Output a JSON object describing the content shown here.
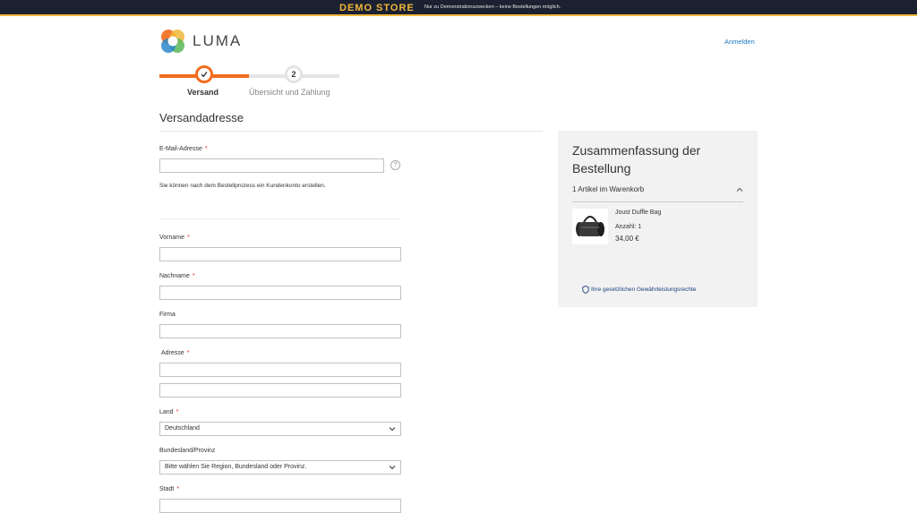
{
  "demo_bar": {
    "title": "DEMO STORE",
    "note": "Nur zu Demonstrationszwecken – keine Bestellungen möglich."
  },
  "header": {
    "logo_icon": "luma-logo-icon",
    "logo_text": "LUMA",
    "signin": "Anmelden"
  },
  "progress": {
    "step1_label": "Versand",
    "step2_number": "2",
    "step2_label": "Übersicht und Zahlung",
    "completed_fraction": 0.5,
    "accent": "#f26c1d"
  },
  "form": {
    "title": "Versandadresse",
    "email_label": "E-Mail-Adresse",
    "email_hint": "Sie können nach dem Bestellprozess ein Kundenkonto erstellen.",
    "help_glyph": "?",
    "firstname_label": "Vorname",
    "lastname_label": "Nachname",
    "company_label": "Firma",
    "address_label": "Adresse",
    "country_label": "Land",
    "country_value": "Deutschland",
    "region_label": "Bundesland/Provinz",
    "region_value": "Bitte wählen Sie Region, Bundesland oder Provinz.",
    "city_label": "Stadt",
    "required_mark": "*"
  },
  "summary": {
    "title": "Zusammenfassung der Bestellung",
    "cart_count": "1 Artikel im Warenkorb",
    "product_name": "Joust Duffle Bag",
    "product_qty": "Anzahl: 1",
    "product_price": "34,00 €",
    "warranty_link": "Ihre gesetzlichen Gewährleistungsrechte",
    "background": "#f2f2f2"
  }
}
